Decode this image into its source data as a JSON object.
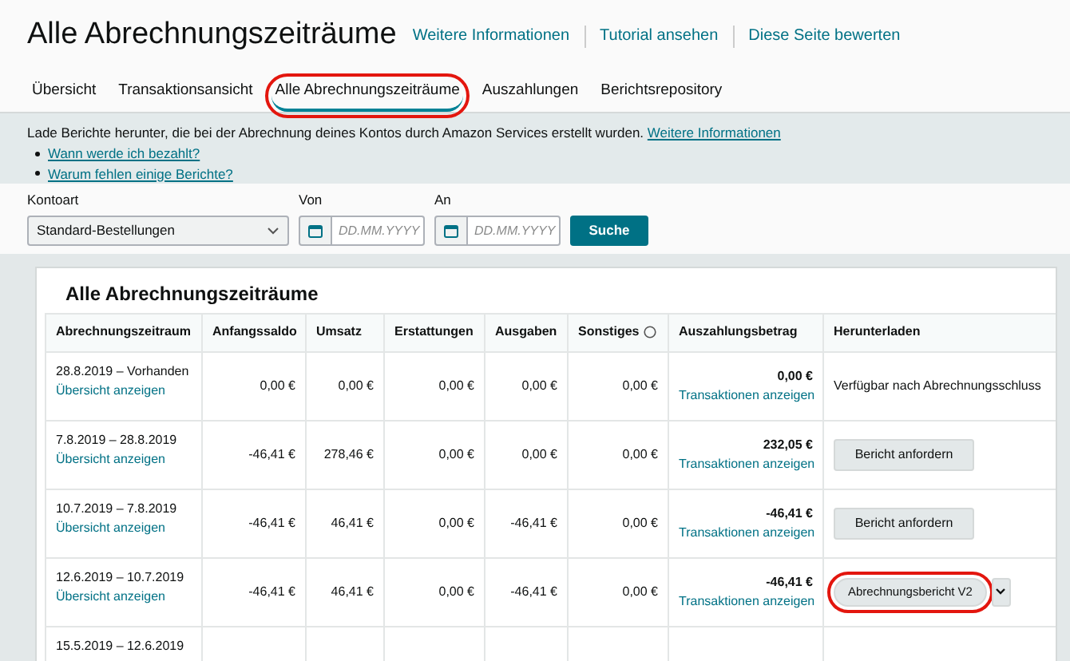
{
  "header": {
    "title": "Alle Abrechnungszeiträume",
    "links": [
      "Weitere Informationen",
      "Tutorial ansehen",
      "Diese Seite bewerten"
    ]
  },
  "tabs": [
    {
      "label": "Übersicht",
      "selected": false,
      "highlighted": false
    },
    {
      "label": "Transaktionsansicht",
      "selected": false,
      "highlighted": false
    },
    {
      "label": "Alle Abrechnungszeiträume",
      "selected": true,
      "highlighted": true
    },
    {
      "label": "Auszahlungen",
      "selected": false,
      "highlighted": false
    },
    {
      "label": "Berichtsrepository",
      "selected": false,
      "highlighted": false
    }
  ],
  "info": {
    "text": "Lade Berichte herunter, die bei der Abrechnung deines Kontos durch Amazon Services erstellt wurden.",
    "link": "Weitere Informationen",
    "bullets": [
      "Wann werde ich bezahlt?",
      "Warum fehlen einige Berichte?"
    ]
  },
  "filters": {
    "account_label": "Kontoart",
    "account_value": "Standard-Bestellungen",
    "from_label": "Von",
    "from_placeholder": "DD.MM.YYYY",
    "to_label": "An",
    "to_placeholder": "DD.MM.YYYY",
    "search_button": "Suche"
  },
  "card": {
    "title": "Alle Abrechnungszeiträume",
    "columns": [
      "Abrechnungszeitraum",
      "Anfangssaldo",
      "Umsatz",
      "Erstattungen",
      "Ausgaben",
      "Sonstiges",
      "Auszahlungsbetrag",
      "Herunterladen"
    ],
    "rows": [
      {
        "period": "28.8.2019 – Vorhanden",
        "overview_link": "Übersicht anzeigen",
        "values": [
          "0,00 €",
          "0,00 €",
          "0,00 €",
          "0,00 €",
          "0,00 €"
        ],
        "payout": "0,00 €",
        "transactions_link": "Transaktionen anzeigen",
        "download": {
          "kind": "text",
          "label": "Verfügbar nach Abrechnungsschluss",
          "highlighted": false
        }
      },
      {
        "period": "7.8.2019 – 28.8.2019",
        "overview_link": "Übersicht anzeigen",
        "values": [
          "-46,41 €",
          "278,46 €",
          "0,00 €",
          "0,00 €",
          "0,00 €"
        ],
        "payout": "232,05 €",
        "transactions_link": "Transaktionen anzeigen",
        "download": {
          "kind": "button",
          "label": "Bericht anfordern",
          "highlighted": false
        }
      },
      {
        "period": "10.7.2019 – 7.8.2019",
        "overview_link": "Übersicht anzeigen",
        "values": [
          "-46,41 €",
          "46,41 €",
          "0,00 €",
          "-46,41 €",
          "0,00 €"
        ],
        "payout": "-46,41 €",
        "transactions_link": "Transaktionen anzeigen",
        "download": {
          "kind": "button",
          "label": "Bericht anfordern",
          "highlighted": false
        }
      },
      {
        "period": "12.6.2019 – 10.7.2019",
        "overview_link": "Übersicht anzeigen",
        "values": [
          "-46,41 €",
          "46,41 €",
          "0,00 €",
          "-46,41 €",
          "0,00 €"
        ],
        "payout": "-46,41 €",
        "transactions_link": "Transaktionen anzeigen",
        "download": {
          "kind": "dropdown",
          "label": "Abrechnungsbericht V2",
          "highlighted": true
        }
      },
      {
        "period": "15.5.2019 – 12.6.2019"
      }
    ]
  }
}
